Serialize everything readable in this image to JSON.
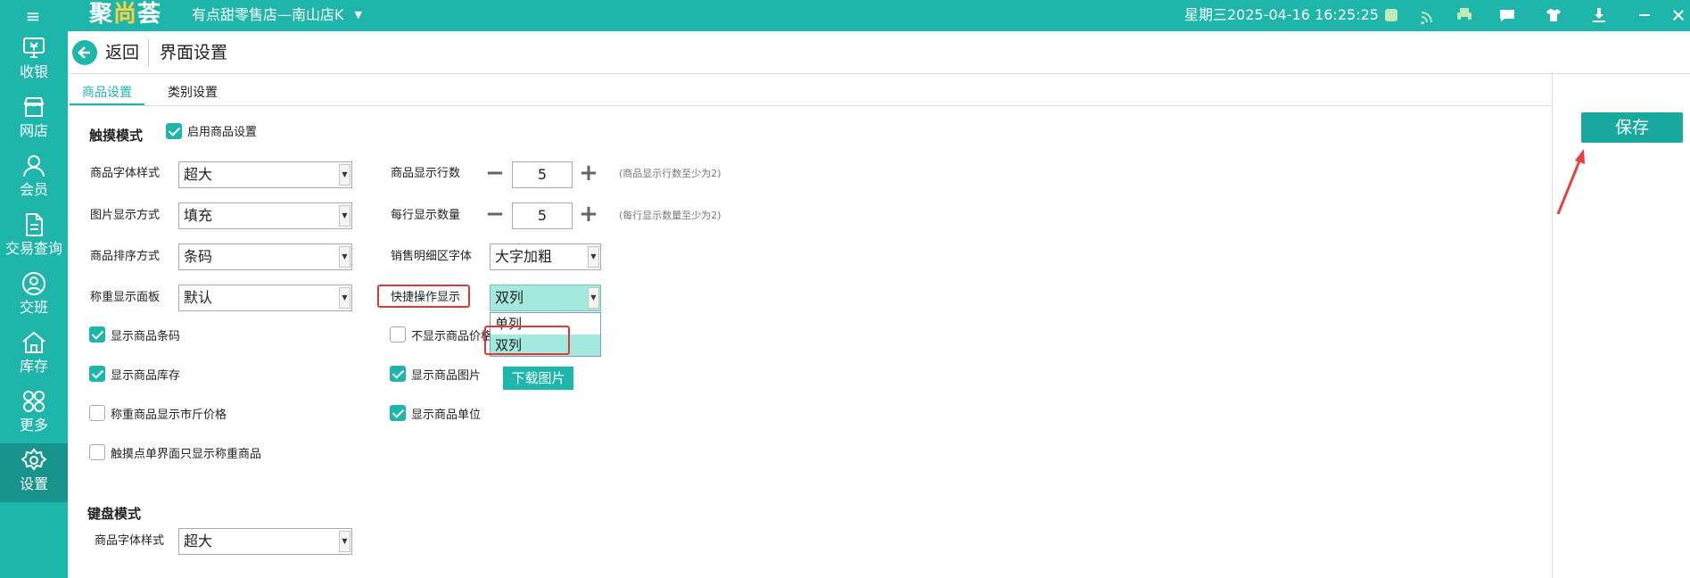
{
  "app": {
    "logo_main": "聚",
    "logo_accent": "尚",
    "logo_rest": "荟",
    "store_name": "有点甜零售店—南山店K",
    "datetime": "星期三2025-04-16 16:25:25",
    "brand_color": "#1eb5ab"
  },
  "sidebar": {
    "items": [
      {
        "label": "收银",
        "icon": "cashier-icon"
      },
      {
        "label": "网店",
        "icon": "online-store-icon"
      },
      {
        "label": "会员",
        "icon": "member-icon"
      },
      {
        "label": "交易查询",
        "icon": "transaction-query-icon"
      },
      {
        "label": "交班",
        "icon": "shift-handover-icon"
      },
      {
        "label": "库存",
        "icon": "inventory-icon"
      },
      {
        "label": "更多",
        "icon": "more-icon"
      },
      {
        "label": "设置",
        "icon": "settings-icon",
        "active": true
      }
    ]
  },
  "header": {
    "back_label": "返回",
    "page_title": "界面设置"
  },
  "tabs": [
    {
      "label": "商品设置",
      "active": true
    },
    {
      "label": "类别设置",
      "active": false
    }
  ],
  "save_label": "保存",
  "touch": {
    "section_title": "触摸模式",
    "enable_label": "启用商品设置",
    "enable_checked": true,
    "font_style": {
      "label": "商品字体样式",
      "value": "超大"
    },
    "image_mode": {
      "label": "图片显示方式",
      "value": "填充"
    },
    "sort_mode": {
      "label": "商品排序方式",
      "value": "条码"
    },
    "weigh_panel": {
      "label": "称重显示面板",
      "value": "默认"
    },
    "rows": {
      "label": "商品显示行数",
      "value": "5",
      "hint": "(商品显示行数至少为2)"
    },
    "per_row": {
      "label": "每行显示数量",
      "value": "5",
      "hint": "(每行显示数量至少为2)"
    },
    "detail_font": {
      "label": "销售明细区字体",
      "value": "大字加粗"
    },
    "quick_op": {
      "label": "快捷操作显示",
      "value": "双列",
      "options": [
        "单列",
        "双列"
      ],
      "selected": "双列"
    },
    "checks": {
      "show_barcode": {
        "label": "显示商品条码",
        "checked": true
      },
      "hide_price": {
        "label": "不显示商品价格",
        "checked": false
      },
      "show_stock": {
        "label": "显示商品库存",
        "checked": true
      },
      "show_image": {
        "label": "显示商品图片",
        "checked": true
      },
      "weigh_jin_price": {
        "label": "称重商品显示市斤价格",
        "checked": false
      },
      "show_unit": {
        "label": "显示商品单位",
        "checked": true
      },
      "touch_only_weigh": {
        "label": "触摸点单界面只显示称重商品",
        "checked": false
      }
    },
    "download_label": "下载图片"
  },
  "keyboard": {
    "section_title": "键盘模式",
    "font_style": {
      "label": "商品字体样式",
      "value": "超大"
    }
  }
}
